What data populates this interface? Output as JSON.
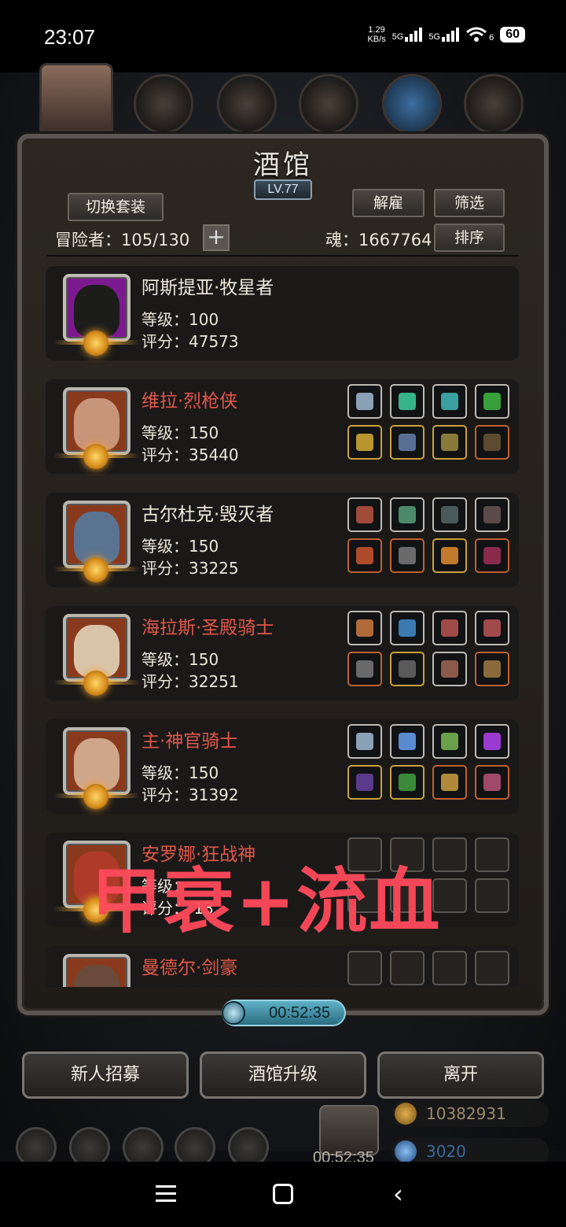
{
  "status_bar": {
    "time": "23:07",
    "net_speed_value": "1.29",
    "net_speed_unit": "KB/s",
    "sim1": "5G",
    "sim2": "5G",
    "wifi_badge": "6",
    "battery": "60"
  },
  "tavern": {
    "title": "酒馆",
    "level": "LV.77",
    "switch_outfit_label": "切换套装",
    "dismiss_label": "解雇",
    "filter_label": "筛选",
    "sort_label": "排序",
    "adventurer_label": "冒险者：105/130",
    "soul_label": "魂：1667764",
    "heroes": [
      {
        "name": "阿斯提亚·牧星者",
        "level": "等级：100",
        "score": "评分：47573",
        "name_color": "#efe9dd"
      },
      {
        "name": "维拉·烈枪侠",
        "level": "等级：150",
        "score": "评分：35440",
        "name_color": "#e2574a"
      },
      {
        "name": "古尔杜克·毁灭者",
        "level": "等级：150",
        "score": "评分：33225",
        "name_color": "#efe9dd"
      },
      {
        "name": "海拉斯·圣殿骑士",
        "level": "等级：150",
        "score": "评分：32251",
        "name_color": "#e2574a"
      },
      {
        "name": "主·神官骑士",
        "level": "等级：150",
        "score": "评分：31392",
        "name_color": "#e2574a"
      },
      {
        "name": "安罗娜·狂战神",
        "level": "等级：",
        "score": "评分：  13",
        "name_color": "#e2574a"
      },
      {
        "name": "曼德尔·剑豪",
        "level": "",
        "score": "",
        "name_color": "#e2574a"
      }
    ],
    "overlay_text": "甲衰+流血",
    "timer": "00:52:35",
    "recruit_label": "新人招募",
    "upgrade_label": "酒馆升级",
    "leave_label": "离开"
  },
  "hud": {
    "gold": "10382931",
    "gems": "3020",
    "chest_timer": "00:52:35"
  }
}
